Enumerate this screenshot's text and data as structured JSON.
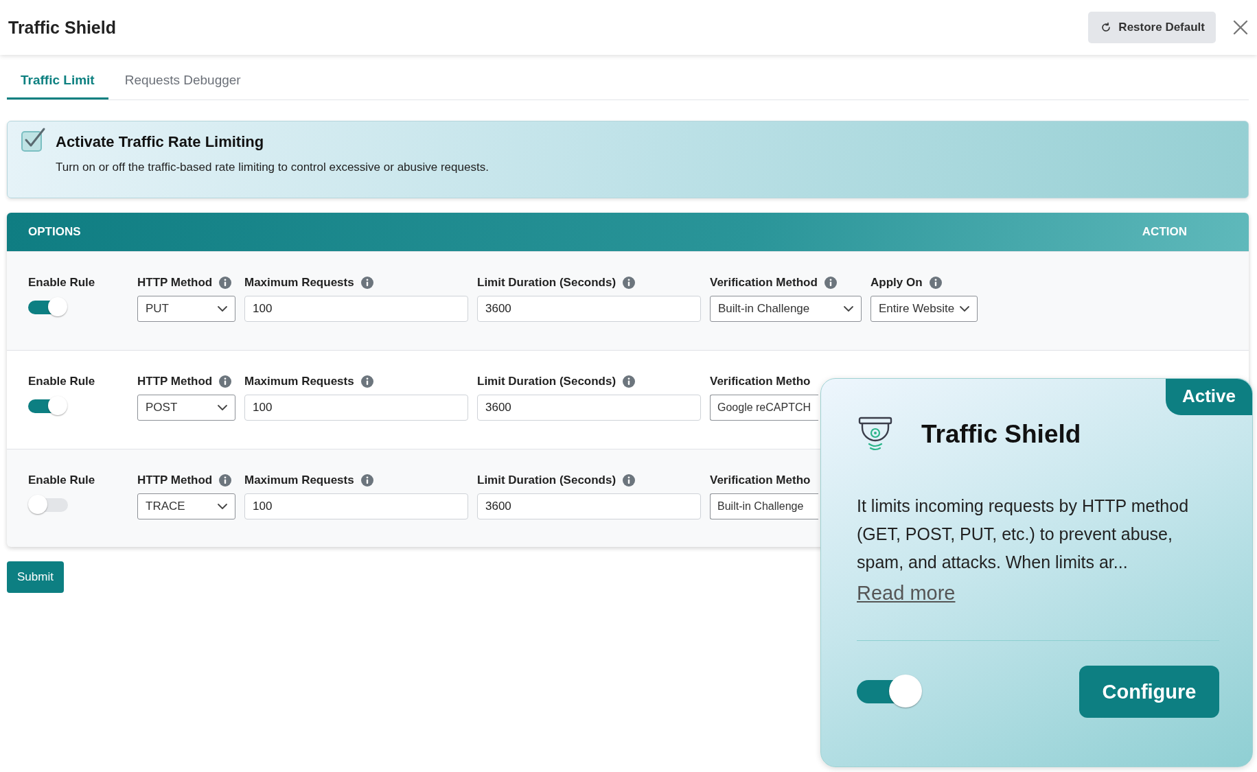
{
  "window": {
    "title": "Traffic Shield",
    "restore_button": "Restore Default"
  },
  "tabs": [
    {
      "label": "Traffic Limit",
      "selected": true
    },
    {
      "label": "Requests Debugger",
      "selected": false
    }
  ],
  "banner": {
    "title": "Activate Traffic Rate Limiting",
    "checked": true,
    "description": "Turn on or off the traffic-based rate limiting to control excessive or abusive requests."
  },
  "options": {
    "header": "OPTIONS",
    "action_header": "ACTION",
    "rows": [
      {
        "fields": [
          {
            "kind": "toggle",
            "label": "Enable Rule",
            "on": true
          },
          {
            "kind": "select",
            "label": "HTTP Method",
            "value": "PUT"
          },
          {
            "kind": "input",
            "label": "Maximum Requests",
            "value": "100"
          },
          {
            "kind": "input",
            "label": "Limit Duration (Seconds)",
            "value": "3600"
          },
          {
            "kind": "select",
            "label": "Verification Method",
            "value": "Built-in Challenge"
          },
          {
            "kind": "select",
            "label": "Apply On",
            "value": "Entire Website"
          }
        ]
      },
      {
        "fields": [
          {
            "kind": "toggle",
            "label": "Enable Rule",
            "on": true
          },
          {
            "kind": "select",
            "label": "HTTP Method",
            "value": "POST"
          },
          {
            "kind": "input",
            "label": "Maximum Requests",
            "value": "100"
          },
          {
            "kind": "input",
            "label": "Limit Duration (Seconds)",
            "value": "3600"
          },
          {
            "kind": "covered",
            "label": "Verification Metho",
            "value": "Google reCAPTCH"
          }
        ]
      },
      {
        "fields": [
          {
            "kind": "toggle",
            "label": "Enable Rule",
            "on": false
          },
          {
            "kind": "select",
            "label": "HTTP Method",
            "value": "TRACE"
          },
          {
            "kind": "input",
            "label": "Maximum Requests",
            "value": "100"
          },
          {
            "kind": "input",
            "label": "Limit Duration (Seconds)",
            "value": "3600"
          },
          {
            "kind": "covered",
            "label": "Verification Metho",
            "value": "Built-in Challenge"
          }
        ]
      }
    ]
  },
  "submit_button": "Submit",
  "card": {
    "badge": "Active",
    "title": "Traffic Shield",
    "description": "It limits incoming requests by HTTP method (GET, POST, PUT, etc.) to prevent abuse, spam, and attacks. When limits ar...",
    "link": "Read more",
    "on": true,
    "button": "Configure"
  }
}
